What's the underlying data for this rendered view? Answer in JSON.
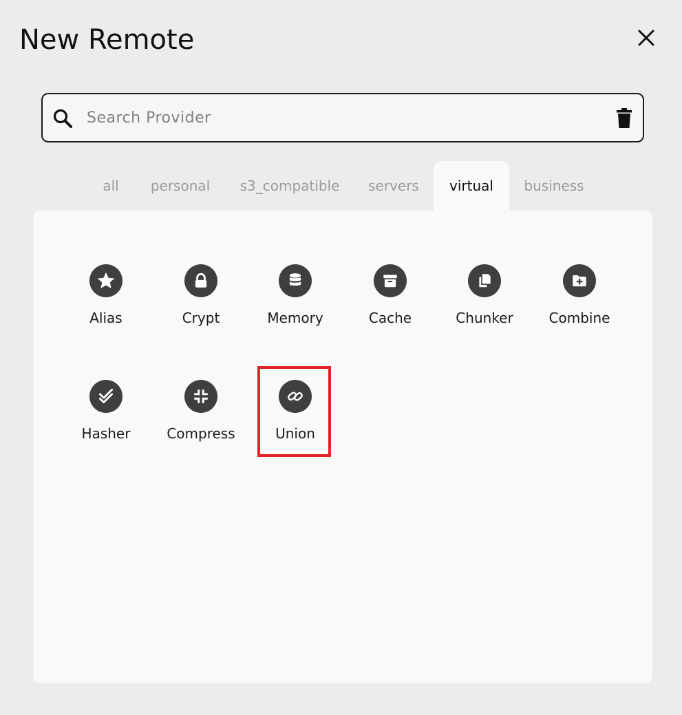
{
  "dialog": {
    "title": "New Remote",
    "close_icon": "close-icon"
  },
  "search": {
    "placeholder": "Search Provider",
    "value": "",
    "search_icon": "search-icon",
    "clear_icon": "trash-icon"
  },
  "tabs": [
    {
      "label": "all",
      "active": false
    },
    {
      "label": "personal",
      "active": false
    },
    {
      "label": "s3_compatible",
      "active": false
    },
    {
      "label": "servers",
      "active": false
    },
    {
      "label": "virtual",
      "active": true
    },
    {
      "label": "business",
      "active": false
    }
  ],
  "providers": [
    {
      "label": "Alias",
      "icon": "star-icon"
    },
    {
      "label": "Crypt",
      "icon": "lock-icon"
    },
    {
      "label": "Memory",
      "icon": "database-icon"
    },
    {
      "label": "Cache",
      "icon": "archive-icon"
    },
    {
      "label": "Chunker",
      "icon": "copy-icon"
    },
    {
      "label": "Combine",
      "icon": "folder-plus-icon"
    },
    {
      "label": "Hasher",
      "icon": "check-double-icon"
    },
    {
      "label": "Compress",
      "icon": "compress-icon"
    },
    {
      "label": "Union",
      "icon": "link-icon",
      "highlighted": true
    }
  ],
  "colors": {
    "background": "#ececec",
    "panel": "#f9f9f9",
    "icon_circle": "#3f3f3f",
    "highlight": "#e3222a",
    "tab_inactive": "#9a9a9a"
  }
}
